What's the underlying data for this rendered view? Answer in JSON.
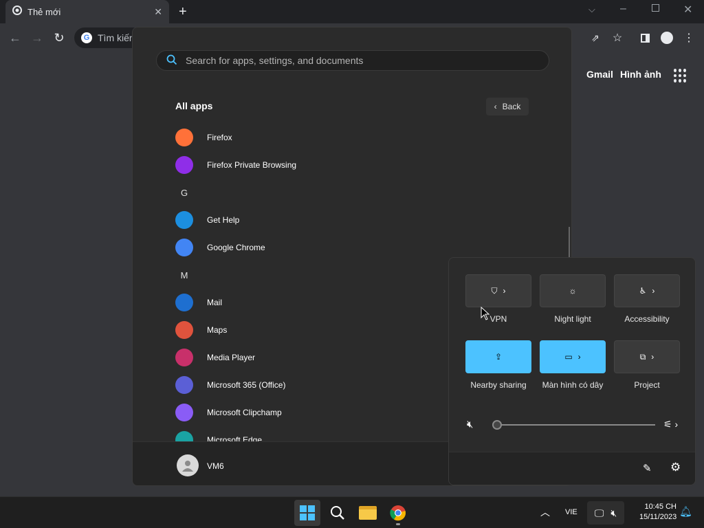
{
  "chrome": {
    "tab_title": "Thẻ mới",
    "omnibox_text": "Tìm kiếm",
    "links": [
      "Gmail",
      "Hình ảnh"
    ]
  },
  "start_menu": {
    "search_placeholder": "Search for apps, settings, and documents",
    "all_apps_title": "All apps",
    "back_label": "Back",
    "apps": [
      {
        "type": "app",
        "label": "Firefox",
        "icon": "firefox-icon",
        "color": "#ff7139"
      },
      {
        "type": "app",
        "label": "Firefox Private Browsing",
        "icon": "firefox-private-icon",
        "color": "#8f2ee8"
      },
      {
        "type": "letter",
        "label": "G"
      },
      {
        "type": "app",
        "label": "Get Help",
        "icon": "get-help-icon",
        "color": "#1c8fe0"
      },
      {
        "type": "app",
        "label": "Google Chrome",
        "icon": "chrome-icon",
        "color": "#4285f4"
      },
      {
        "type": "letter",
        "label": "M"
      },
      {
        "type": "app",
        "label": "Mail",
        "icon": "mail-icon",
        "color": "#1e6fd0"
      },
      {
        "type": "app",
        "label": "Maps",
        "icon": "maps-icon",
        "color": "#e0533d"
      },
      {
        "type": "app",
        "label": "Media Player",
        "icon": "media-player-icon",
        "color": "#c8306a"
      },
      {
        "type": "app",
        "label": "Microsoft 365 (Office)",
        "icon": "office-icon",
        "color": "#5b5fd6"
      },
      {
        "type": "app",
        "label": "Microsoft Clipchamp",
        "icon": "clipchamp-icon",
        "color": "#8a5cf6"
      },
      {
        "type": "app",
        "label": "Microsoft Edge",
        "icon": "edge-icon",
        "color": "#1aa3a3"
      }
    ],
    "user_name": "VM6"
  },
  "quick_settings": {
    "tiles": [
      {
        "label": "VPN",
        "icon": "shield-icon",
        "on": false,
        "chevron": true
      },
      {
        "label": "Night light",
        "icon": "night-light-icon",
        "on": false,
        "chevron": false
      },
      {
        "label": "Accessibility",
        "icon": "accessibility-icon",
        "on": false,
        "chevron": true
      },
      {
        "label": "Nearby sharing",
        "icon": "share-icon",
        "on": true,
        "chevron": false
      },
      {
        "label": "Màn hình có dây",
        "icon": "cast-icon",
        "on": true,
        "chevron": true
      },
      {
        "label": "Project",
        "icon": "project-icon",
        "on": false,
        "chevron": true
      }
    ],
    "volume_level": 0
  },
  "taskbar": {
    "language": "VIE",
    "time": "10:45 CH",
    "date": "15/11/2023"
  },
  "colors": {
    "accent": "#4cc2ff",
    "start_bg": "#2b2b2b",
    "taskbar_bg": "#1f1f1f"
  }
}
